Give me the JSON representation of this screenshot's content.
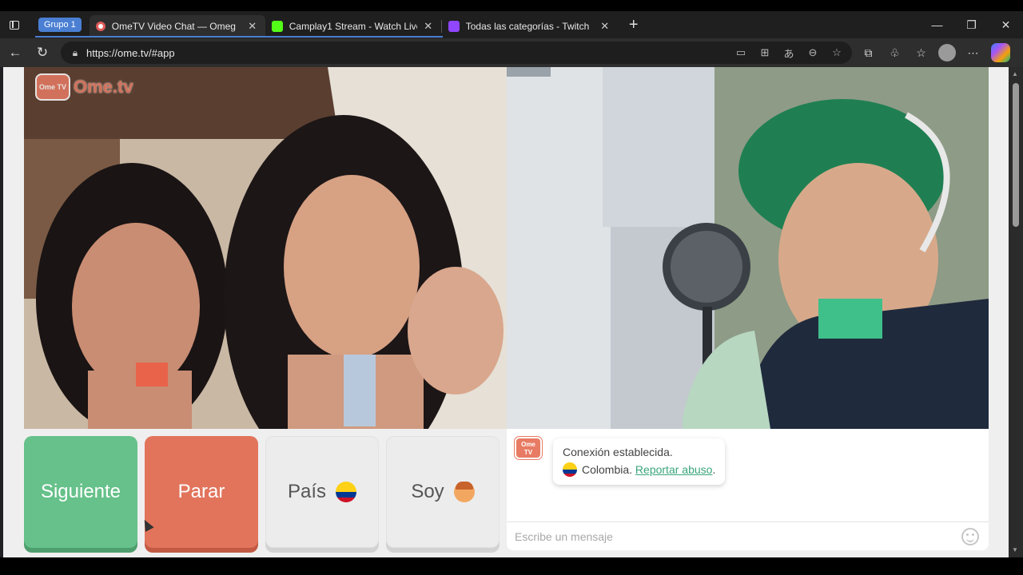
{
  "browser": {
    "group_label": "Grupo 1",
    "tabs": [
      {
        "title": "OmeTV Video Chat — Omeg",
        "active": true,
        "favicon_color": "#e05a5a"
      },
      {
        "title": "Camplay1 Stream - Watch Live on",
        "active": false,
        "favicon_color": "#53fc18"
      },
      {
        "title": "Todas las categorías - Twitch",
        "active": false,
        "favicon_color": "#9146ff"
      }
    ],
    "newtab_symbol": "+",
    "window_controls": {
      "minimize": "—",
      "restore": "❐",
      "close": "✕"
    },
    "url": "https://ome.tv/#app"
  },
  "app": {
    "logo_text": "Ome.tv",
    "logo_badge": "Ome TV",
    "buttons": {
      "next": "Siguiente",
      "stop": "Parar",
      "country": "País",
      "soy": "Soy"
    },
    "chat": {
      "status": "Conexión establecida.",
      "country": "Colombia.",
      "report": "Reportar abuso",
      "report_suffix": ".",
      "placeholder": "Escribe un mensaje"
    },
    "colors": {
      "next": "#66c18a",
      "stop": "#e2745c",
      "brand": "#e87b63",
      "link": "#3aa57a"
    }
  }
}
